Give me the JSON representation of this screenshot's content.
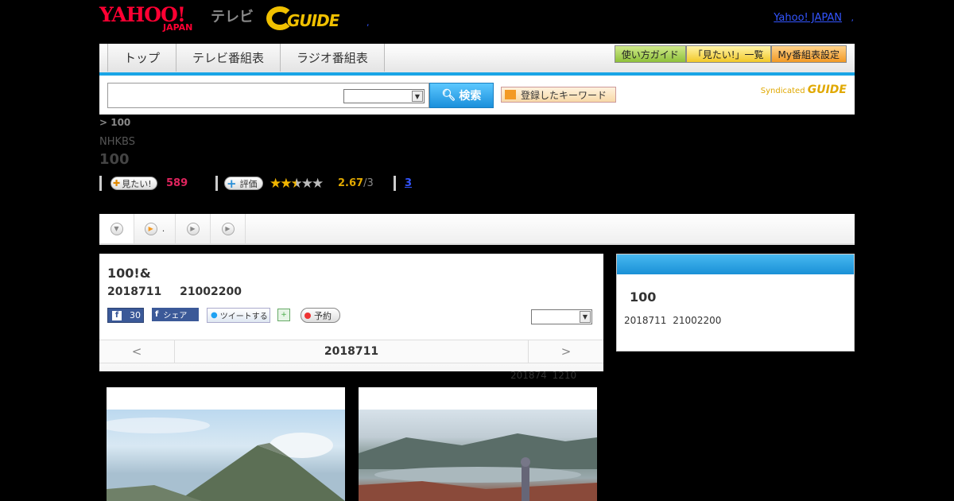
{
  "header": {
    "logo_yahoo": "YAHOO!",
    "logo_japan": "JAPAN",
    "logo_tv": "テレビ",
    "logo_gguide": "GUIDE",
    "dot_link": ",",
    "yahoo_japan_link": "Yahoo! JAPAN",
    "yahoo_japan_suffix": ","
  },
  "nav": {
    "tabs": [
      "トップ",
      "テレビ番組表",
      "ラジオ番組表"
    ],
    "right_buttons": [
      "使い方ガイド",
      "「見たい!」一覧",
      "My番組表設定"
    ]
  },
  "search": {
    "input_value": "",
    "select_value": "",
    "search_label": "検索",
    "keyword_label": "登録したキーワード",
    "syndicated": "Syndicated",
    "syndicated_logo": "GUIDE"
  },
  "program": {
    "breadcrumb": "> 100",
    "channel": "NHKBS",
    "title": "100",
    "want_label": "見たい!",
    "want_count": "589",
    "rate_label": "評価",
    "rating": "2.67",
    "rating_max": "/3",
    "review_count": "3"
  },
  "tabs2": {
    "tab2_label": "."
  },
  "card": {
    "title": "100!&",
    "date": "2018711",
    "time": "21002200",
    "fb_count": "30",
    "fb_share": "シェア",
    "tweet": "ツイートする",
    "reserve": "予約",
    "select_value": "",
    "nav_prev": "<",
    "nav_date": "2018711",
    "nav_next": ">"
  },
  "update_note": {
    "date": "201874",
    "time": "1210"
  },
  "side": {
    "title": "100",
    "date": "2018711",
    "time": "21002200"
  },
  "colors": {
    "accent_blue": "#1aa5e6",
    "yahoo_red": "#ff0033",
    "want_pink": "#e0245e",
    "star_gold": "#f0b400"
  }
}
